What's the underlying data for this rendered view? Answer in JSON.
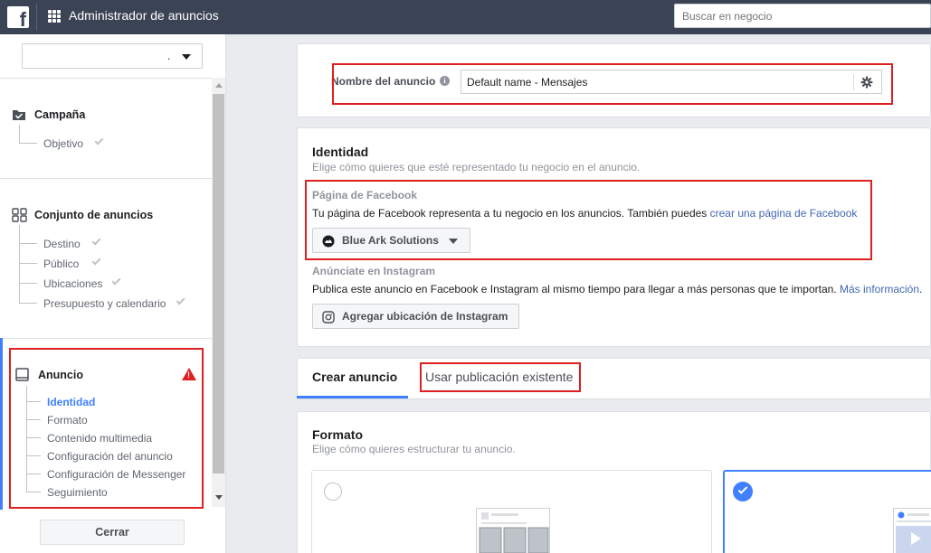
{
  "topbar": {
    "logo_letter": "f",
    "app_title": "Administrador de anuncios",
    "search_placeholder": "Buscar en negocio"
  },
  "sidebar": {
    "account_value": ".",
    "campaign": {
      "title": "Campaña",
      "items": [
        {
          "label": "Objetivo"
        }
      ]
    },
    "adset": {
      "title": "Conjunto de anuncios",
      "items": [
        {
          "label": "Destino"
        },
        {
          "label": "Público"
        },
        {
          "label": "Ubicaciones"
        },
        {
          "label": "Presupuesto y calendario"
        }
      ]
    },
    "ad": {
      "title": "Anuncio",
      "items": [
        {
          "label": "Identidad",
          "active": true
        },
        {
          "label": "Formato"
        },
        {
          "label": "Contenido multimedia"
        },
        {
          "label": "Configuración del anuncio"
        },
        {
          "label": "Configuración de Messenger"
        },
        {
          "label": "Seguimiento"
        }
      ]
    },
    "close_label": "Cerrar"
  },
  "ad_name": {
    "label": "Nombre del anuncio",
    "value": "Default name - Mensajes"
  },
  "identity": {
    "title": "Identidad",
    "description": "Elige cómo quieres que esté representado tu negocio en el anuncio.",
    "facebook_page": {
      "heading": "Página de Facebook",
      "text": "Tu página de Facebook representa a tu negocio en los anuncios. También puedes ",
      "link": "crear una página de Facebook",
      "selected_page": "Blue Ark Solutions"
    },
    "instagram": {
      "heading": "Anúnciate en Instagram",
      "text": "Publica este anuncio en Facebook e Instagram al mismo tiempo para llegar a más personas que te importan. ",
      "link": "Más información",
      "after_link": ".",
      "button": "Agregar ubicación de Instagram"
    }
  },
  "tabs": {
    "create": "Crear anuncio",
    "existing": "Usar publicación existente"
  },
  "format": {
    "title": "Formato",
    "description": "Elige cómo quieres estructurar tu anuncio."
  },
  "colors": {
    "accent": "#4080ff",
    "highlight": "#e02020",
    "topbar": "#3b4455",
    "link": "#4267b2"
  }
}
